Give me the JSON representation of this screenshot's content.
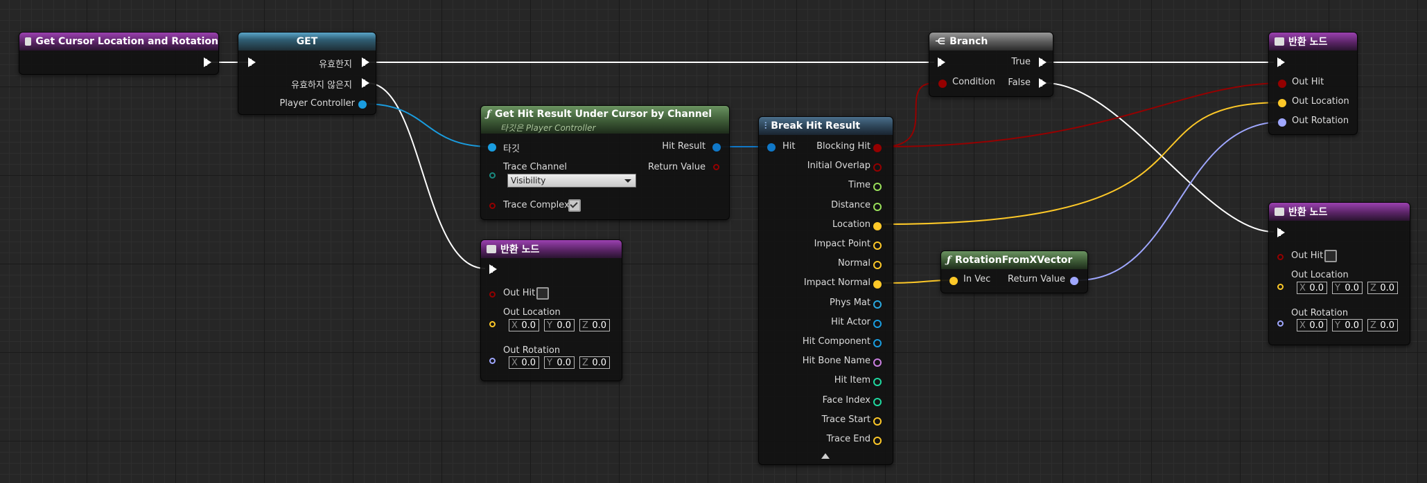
{
  "colors": {
    "exec": "#ffffff",
    "bool": "#950000",
    "vector": "#fdc828",
    "rotator": "#9fa7ff",
    "object": "#1a9de0",
    "struct": "#1078c8",
    "float": "#9ae05a",
    "int": "#20d8a0",
    "name": "#c97fe0",
    "material": "#2aa8e0",
    "channel": "#1a8a80"
  },
  "nodes": {
    "cursor": {
      "title": "Get Cursor Location and Rotation"
    },
    "get": {
      "title": "GET",
      "valid": "유효한지",
      "invalid": "유효하지 않은지",
      "pc": "Player Controller"
    },
    "hitresult": {
      "title": "Get Hit Result Under Cursor by Channel",
      "subtitle": "타깃은 Player Controller",
      "target": "타깃",
      "hit_result": "Hit Result",
      "trace_channel": "Trace Channel",
      "trace_channel_value": "Visibility",
      "return_value": "Return Value",
      "trace_complex": "Trace Complex"
    },
    "ret1": {
      "title": "반환 노드",
      "out_hit": "Out Hit",
      "out_location": "Out Location",
      "out_rotation": "Out Rotation",
      "x": "0.0",
      "y": "0.0",
      "z": "0.0"
    },
    "break": {
      "title": "Break Hit Result",
      "hit": "Hit",
      "pins": [
        "Blocking Hit",
        "Initial Overlap",
        "Time",
        "Distance",
        "Location",
        "Impact Point",
        "Normal",
        "Impact Normal",
        "Phys Mat",
        "Hit Actor",
        "Hit Component",
        "Hit Bone Name",
        "Hit Item",
        "Face Index",
        "Trace Start",
        "Trace End"
      ]
    },
    "branch": {
      "title": "Branch",
      "true_label": "True",
      "false_label": "False",
      "condition": "Condition"
    },
    "rot": {
      "title": "RotationFromXVector",
      "in_vec": "In Vec",
      "return_value": "Return Value"
    },
    "ret2": {
      "title": "반환 노드",
      "out_hit": "Out Hit",
      "out_location": "Out Location",
      "out_rotation": "Out Rotation"
    },
    "ret3": {
      "title": "반환 노드",
      "out_hit": "Out Hit",
      "out_location": "Out Location",
      "out_rotation": "Out Rotation",
      "x": "0.0",
      "y": "0.0",
      "z": "0.0"
    }
  },
  "axis_labels": {
    "x": "X",
    "y": "Y",
    "z": "Z"
  }
}
